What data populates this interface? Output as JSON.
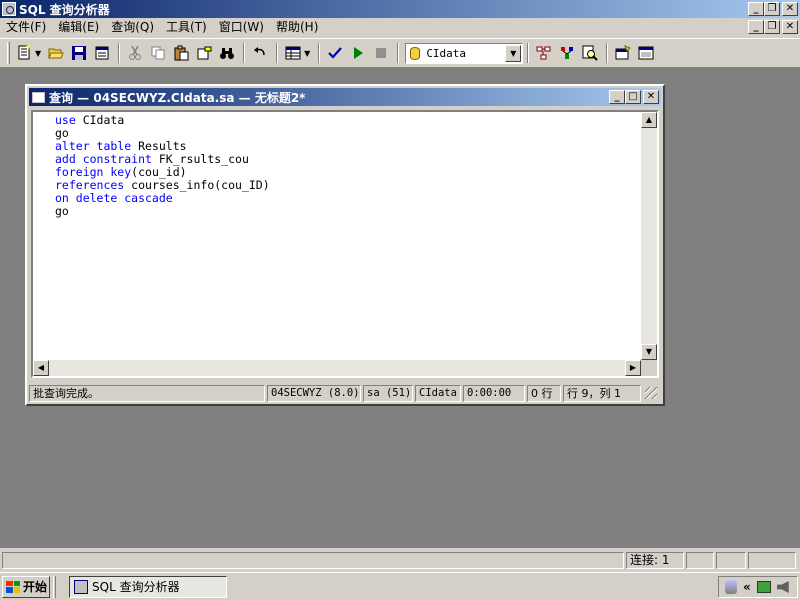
{
  "window": {
    "title": "SQL 查询分析器"
  },
  "menu": {
    "items": [
      "文件(F)",
      "编辑(E)",
      "查询(Q)",
      "工具(T)",
      "窗口(W)",
      "帮助(H)"
    ]
  },
  "toolbar": {
    "database_value": "CIdata",
    "icons": [
      "new-query-icon",
      "open-icon",
      "save-icon",
      "load-script-icon",
      "cut-icon",
      "copy-icon",
      "paste-icon",
      "clear-icon",
      "find-icon",
      "undo-icon",
      "results-grid-icon",
      "parse-icon",
      "execute-icon",
      "cancel-icon",
      "object-browser-icon",
      "estimated-plan-icon",
      "object-search-icon",
      "current-connection-icon",
      "show-results-icon"
    ]
  },
  "query_window": {
    "title": "查询 — 04SECWYZ.CIdata.sa — 无标题2*",
    "code_lines": [
      [
        {
          "t": "use",
          "kw": true
        },
        {
          "t": " CIdata",
          "kw": false
        }
      ],
      [
        {
          "t": "go",
          "kw": false
        }
      ],
      [
        {
          "t": "alter table",
          "kw": true
        },
        {
          "t": " Results",
          "kw": false
        }
      ],
      [
        {
          "t": "add constraint",
          "kw": true
        },
        {
          "t": " FK_rsults_cou",
          "kw": false
        }
      ],
      [
        {
          "t": "foreign key",
          "kw": true
        },
        {
          "t": "(cou_id)",
          "kw": false
        }
      ],
      [
        {
          "t": "references",
          "kw": true
        },
        {
          "t": " courses_info(cou_ID)",
          "kw": false
        }
      ],
      [
        {
          "t": "on delete cascade",
          "kw": true
        }
      ],
      [
        {
          "t": "go",
          "kw": false
        }
      ]
    ],
    "status": {
      "message": "批查询完成。",
      "server": "04SECWYZ (8.0)",
      "user": "sa (51)",
      "database": "CIdata",
      "elapsed": "0:00:00",
      "rows": "0 行",
      "position": "行 9，列 1"
    }
  },
  "statusbar": {
    "connections": "连接: 1"
  },
  "taskbar": {
    "start_label": "开始",
    "task_label": "SQL 查询分析器"
  },
  "colors": {
    "keyword": "#0000ff",
    "titlebar_start": "#0a246a",
    "titlebar_end": "#a6caf0",
    "mdi_background": "#808080"
  }
}
